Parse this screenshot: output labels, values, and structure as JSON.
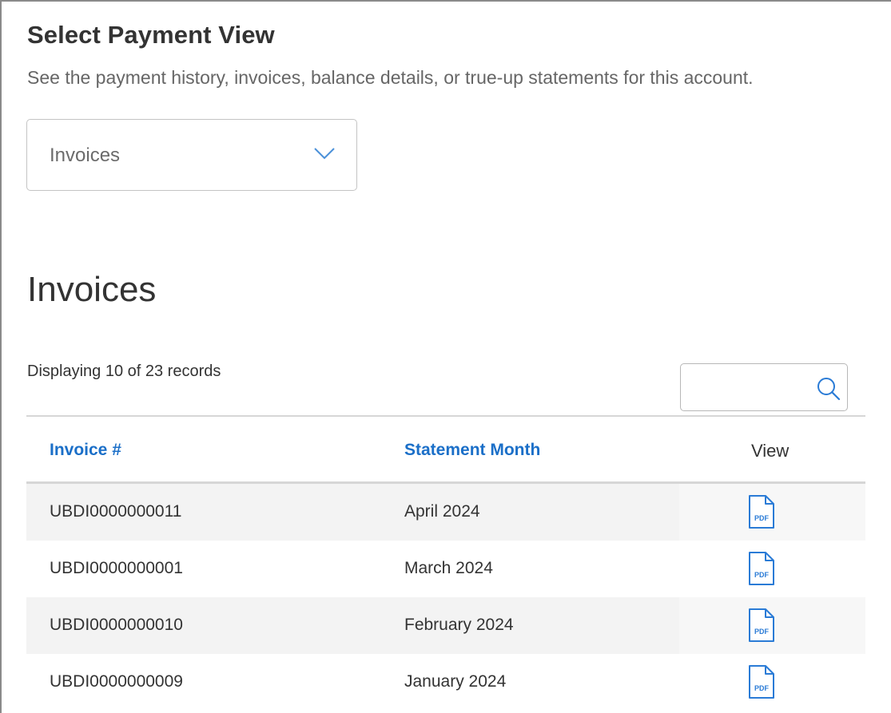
{
  "header": {
    "title": "Select Payment View",
    "subtitle": "See the payment history, invoices, balance details, or true-up statements for this account."
  },
  "view_select": {
    "selected": "Invoices",
    "icon": "chevron-down-icon"
  },
  "invoices": {
    "title": "Invoices",
    "records_text": "Displaying 10 of 23 records",
    "search": {
      "placeholder": "",
      "icon": "search-icon"
    },
    "columns": [
      "Invoice #",
      "Statement Month",
      "View"
    ],
    "rows": [
      {
        "invoice": "UBDI0000000011",
        "month": "April 2024",
        "view_icon": "pdf-icon",
        "view_label": "PDF"
      },
      {
        "invoice": "UBDI0000000001",
        "month": "March 2024",
        "view_icon": "pdf-icon",
        "view_label": "PDF"
      },
      {
        "invoice": "UBDI0000000010",
        "month": "February 2024",
        "view_icon": "pdf-icon",
        "view_label": "PDF"
      },
      {
        "invoice": "UBDI0000000009",
        "month": "January 2024",
        "view_icon": "pdf-icon",
        "view_label": "PDF"
      }
    ]
  },
  "colors": {
    "link_blue": "#1b6fc8",
    "icon_blue": "#2a7bd6",
    "row_shade": "#f3f3f3"
  }
}
